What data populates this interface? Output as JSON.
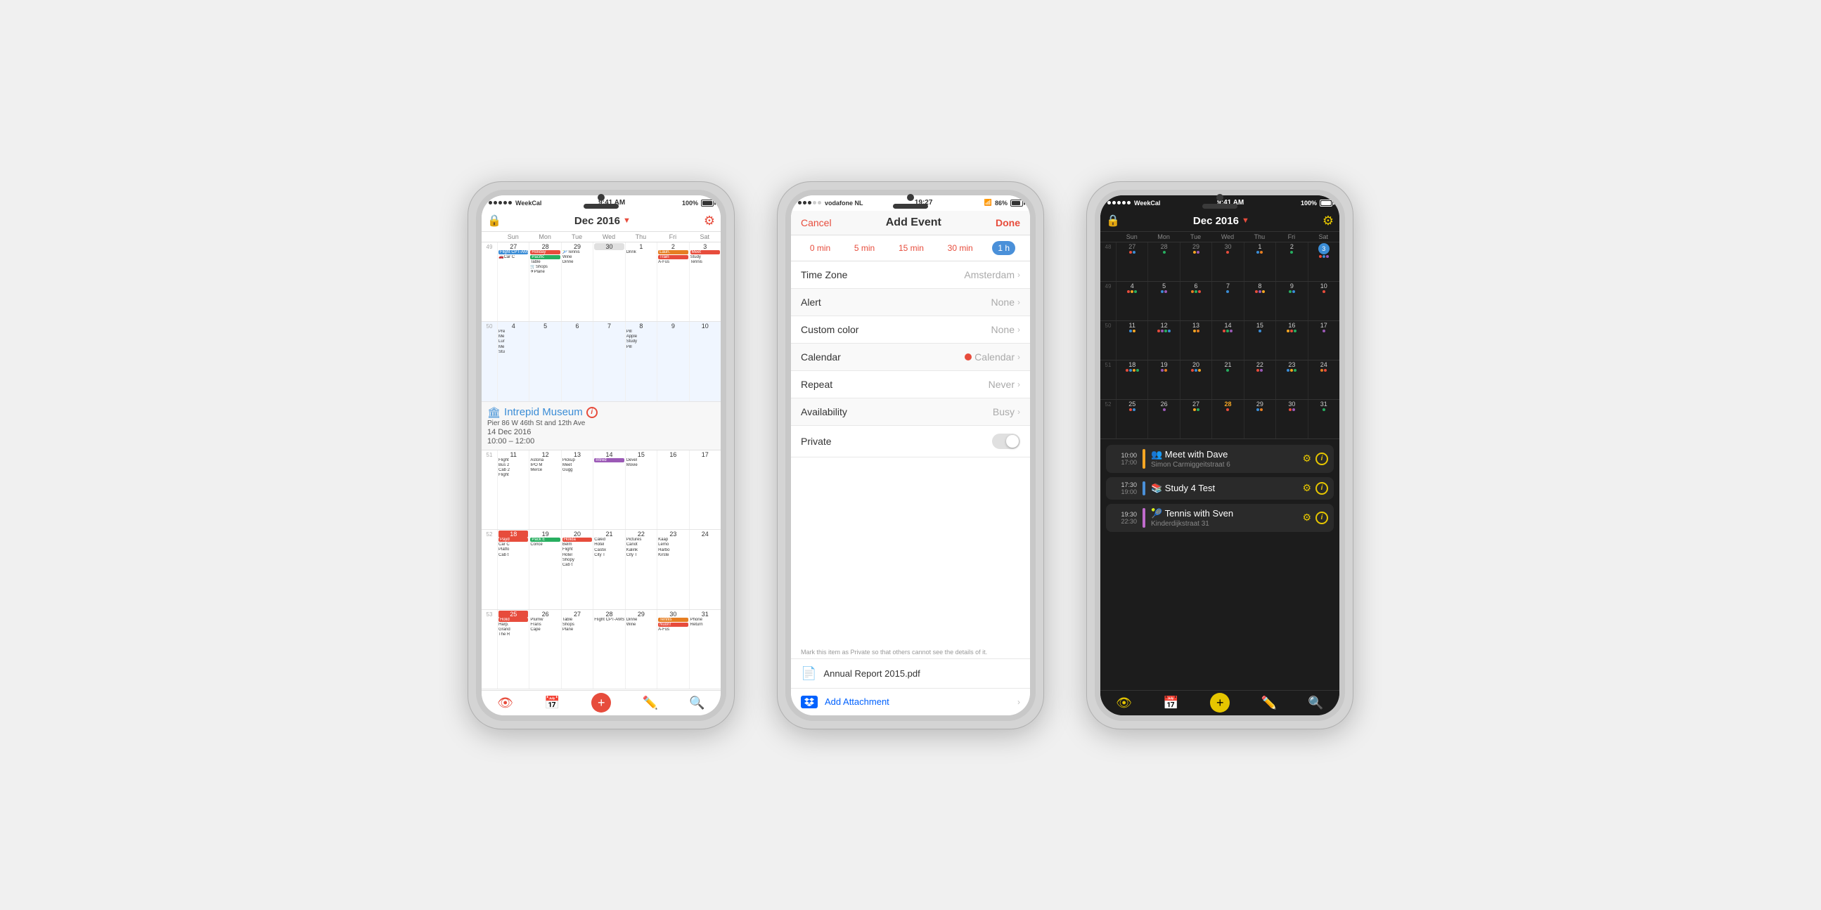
{
  "phone1": {
    "status": {
      "carrier": "WeekCal",
      "time": "9:41 AM",
      "battery": "100%",
      "wifi": true
    },
    "header": {
      "lock_icon": "🔒",
      "month": "Dec 2016",
      "arrow": "▼",
      "gear": "⚙"
    },
    "days": [
      "Sun",
      "Mon",
      "Tue",
      "Wed",
      "Thu",
      "Fri",
      "Sat"
    ],
    "selected_event": {
      "icon": "🏛",
      "title": "Intrepid Museum",
      "subtitle": "Pier 86 W 46th St and 12th Ave",
      "date": "14 Dec 2016",
      "time": "10:00 – 12:00"
    },
    "toolbar_icons": [
      "👁",
      "📅",
      "➕",
      "✏",
      "🔍"
    ]
  },
  "phone2": {
    "status": {
      "carrier": "vodafone NL",
      "time": "19:27",
      "battery": "86%",
      "wifi": true,
      "bluetooth": true
    },
    "nav": {
      "cancel": "Cancel",
      "title": "Add Event",
      "done": "Done"
    },
    "alert_times": [
      "0 min",
      "5 min",
      "15 min",
      "30 min",
      "1 h"
    ],
    "active_alert": "1 h",
    "rows": [
      {
        "label": "Time Zone",
        "value": "Amsterdam",
        "shaded": false
      },
      {
        "label": "Alert",
        "value": "None",
        "shaded": true
      },
      {
        "label": "Custom color",
        "value": "None",
        "shaded": false
      },
      {
        "label": "Calendar",
        "value": "Calendar",
        "has_dot": true,
        "shaded": true
      },
      {
        "label": "Repeat",
        "value": "Never",
        "shaded": false
      },
      {
        "label": "Availability",
        "value": "Busy",
        "shaded": true
      },
      {
        "label": "Private",
        "value": "toggle",
        "shaded": false
      }
    ],
    "private_note": "Mark this item as Private so that others cannot see the details of it.",
    "attachment": {
      "label": "Annual Report 2015.pdf"
    },
    "add_attachment": {
      "label": "Add Attachment"
    }
  },
  "phone3": {
    "status": {
      "carrier": "WeekCal",
      "time": "9:41 AM",
      "battery": "100%",
      "wifi": true
    },
    "header": {
      "lock_icon": "🔒",
      "month": "Dec 2016",
      "arrow": "▼",
      "gear": "⚙"
    },
    "days": [
      "Sun",
      "Mon",
      "Tue",
      "Wed",
      "Thu",
      "Fri",
      "Sat"
    ],
    "today": "3",
    "events": [
      {
        "start": "10:00",
        "end": "17:00",
        "color": "#f5a623",
        "icon": "👥",
        "title": "Meet with Dave",
        "subtitle": "Simon Carmiggeitstraat 6"
      },
      {
        "start": "17:30",
        "end": "19:00",
        "color": "#4a90d9",
        "icon": "📚",
        "title": "Study 4 Test",
        "subtitle": ""
      },
      {
        "start": "19:30",
        "end": "22:30",
        "color": "#c06bcc",
        "icon": "🎾",
        "title": "Tennis with Sven",
        "subtitle": "Kinderdijkstraat 31"
      }
    ],
    "toolbar_icons": [
      "👁",
      "📅",
      "➕",
      "✏",
      "🔍"
    ]
  }
}
